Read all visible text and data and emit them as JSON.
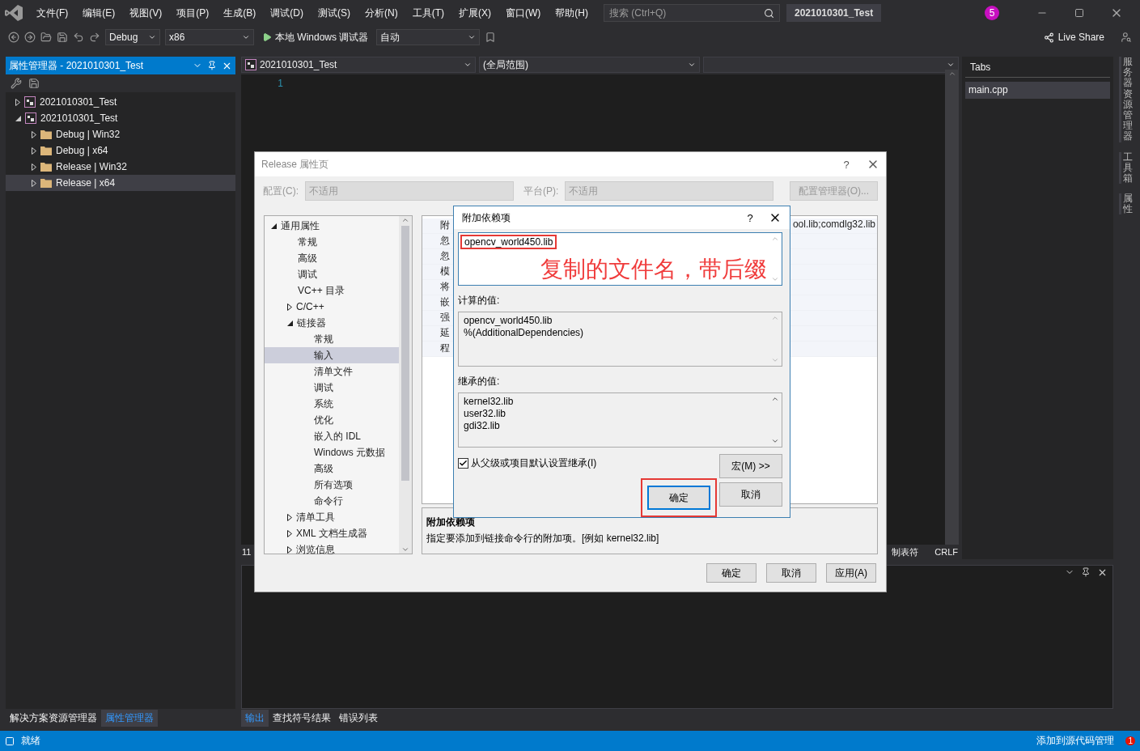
{
  "menu_bar": {
    "menus": [
      "文件(F)",
      "编辑(E)",
      "视图(V)",
      "项目(P)",
      "生成(B)",
      "调试(D)",
      "测试(S)",
      "分析(N)",
      "工具(T)",
      "扩展(X)",
      "窗口(W)",
      "帮助(H)"
    ],
    "search": {
      "placeholder": "搜索 (Ctrl+Q)"
    },
    "title": "2021010301_Test",
    "notification_count": "5"
  },
  "toolbar": {
    "configuration": "Debug",
    "platform": "x86",
    "run_label": "本地 Windows 调试器",
    "run_mode": "自动",
    "live_share": "Live Share"
  },
  "property_manager": {
    "title": "属性管理器 - 2021010301_Test",
    "tree": [
      {
        "label": "2021010301_Test",
        "kind": "project",
        "expanded": false,
        "selected": false
      },
      {
        "label": "2021010301_Test",
        "kind": "project",
        "expanded": true,
        "selected": false,
        "children": [
          {
            "label": "Debug | Win32",
            "kind": "folder",
            "expanded": false,
            "selected": false
          },
          {
            "label": "Debug | x64",
            "kind": "folder",
            "expanded": false,
            "selected": false
          },
          {
            "label": "Release | Win32",
            "kind": "folder",
            "expanded": false,
            "selected": false
          },
          {
            "label": "Release | x64",
            "kind": "folder",
            "expanded": false,
            "selected": true
          }
        ]
      }
    ]
  },
  "left_tabs": [
    {
      "label": "解决方案资源管理器",
      "selected": false
    },
    {
      "label": "属性管理器",
      "selected": true
    }
  ],
  "editor": {
    "project": "2021010301_Test",
    "scope": "(全局范围)",
    "line_numbers": [
      "1"
    ],
    "zoom": "11",
    "status": [
      "制表符",
      "CRLF"
    ]
  },
  "tabs_panel": {
    "title": "Tabs",
    "items": [
      {
        "label": "main.cpp",
        "selected": true
      }
    ]
  },
  "side_tabs": [
    "服务器资源管理器",
    "工具箱",
    "属性"
  ],
  "output_tabs": [
    {
      "label": "输出",
      "selected": true
    },
    {
      "label": "查找符号结果",
      "selected": false
    },
    {
      "label": "错误列表",
      "selected": false
    }
  ],
  "status_bar": {
    "text": "就绪",
    "source_control": "添加到源代码管理",
    "notification_count": "1"
  },
  "property_dialog": {
    "title": "Release 属性页",
    "help": "?",
    "configuration_label": "配置(C):",
    "configuration": "不适用",
    "platform_label": "平台(P):",
    "platform": "不适用",
    "config_manager": "配置管理器(O)...",
    "tree": [
      {
        "label": "通用属性",
        "expanded": true,
        "selected": false,
        "children": [
          {
            "label": "常规",
            "selected": false
          },
          {
            "label": "高级",
            "selected": false
          },
          {
            "label": "调试",
            "selected": false
          },
          {
            "label": "VC++ 目录",
            "selected": false
          },
          {
            "label": "C/C++",
            "expanded": false,
            "selected": false
          },
          {
            "label": "链接器",
            "expanded": true,
            "selected": false,
            "children": [
              {
                "label": "常规",
                "selected": false
              },
              {
                "label": "输入",
                "selected": true
              },
              {
                "label": "清单文件",
                "selected": false
              },
              {
                "label": "调试",
                "selected": false
              },
              {
                "label": "系统",
                "selected": false
              },
              {
                "label": "优化",
                "selected": false
              },
              {
                "label": "嵌入的 IDL",
                "selected": false
              },
              {
                "label": "Windows 元数据",
                "selected": false
              },
              {
                "label": "高级",
                "selected": false
              },
              {
                "label": "所有选项",
                "selected": false
              },
              {
                "label": "命令行",
                "selected": false
              }
            ]
          },
          {
            "label": "清单工具",
            "expanded": false,
            "selected": false
          },
          {
            "label": "XML 文档生成器",
            "expanded": false,
            "selected": false
          },
          {
            "label": "浏览信息",
            "expanded": false,
            "selected": false
          }
        ]
      }
    ],
    "grid_rows": [
      {
        "label": "附",
        "value": "ool.lib;comdlg32.lib"
      },
      {
        "label": "忽"
      },
      {
        "label": "忽"
      },
      {
        "label": "模"
      },
      {
        "label": "将"
      },
      {
        "label": "嵌"
      },
      {
        "label": "强"
      },
      {
        "label": "延"
      },
      {
        "label": "程"
      }
    ],
    "description": {
      "title": "附加依赖项",
      "text": "指定要添加到链接命令行的附加项。[例如 kernel32.lib]"
    },
    "buttons": [
      "确定",
      "取消",
      "应用(A)"
    ]
  },
  "dependencies_dialog": {
    "title": "附加依赖项",
    "help": "?",
    "value": "opencv_world450.lib",
    "annotation": "复制的文件名，带后缀",
    "evaluated_label": "计算的值:",
    "evaluated": [
      "opencv_world450.lib",
      "%(AdditionalDependencies)"
    ],
    "inherited_label": "继承的值:",
    "inherited": [
      "kernel32.lib",
      "user32.lib",
      "gdi32.lib"
    ],
    "inherit": {
      "label": "从父级或项目默认设置继承(I)",
      "checked": true
    },
    "macros_button": "宏(M) >>",
    "buttons": [
      "确定",
      "取消"
    ]
  }
}
